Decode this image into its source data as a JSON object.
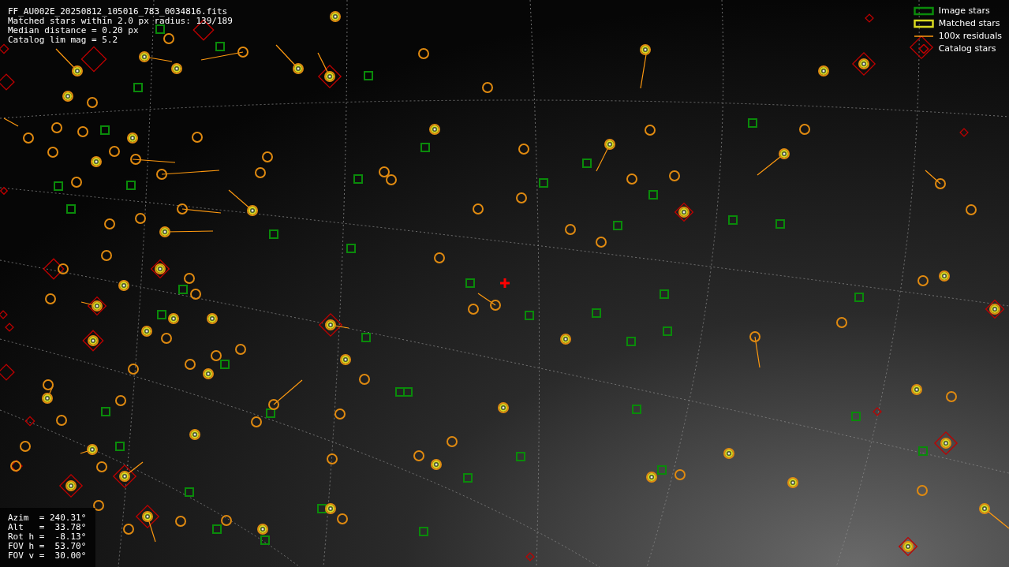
{
  "info": [
    "FF_AU002E_20250812_105016_783_0034816.fits",
    "Matched stars within 2.0 px radius: 139/189",
    "Median distance = 0.20 px",
    "Catalog lim mag = 5.2"
  ],
  "legend": [
    {
      "kind": "image",
      "label": "Image stars"
    },
    {
      "kind": "matched",
      "label": "Matched stars"
    },
    {
      "kind": "residual",
      "label": "100x residuals"
    },
    {
      "kind": "catalog",
      "label": "Catalog stars"
    }
  ],
  "pointing": [
    "Azim  = 240.31°",
    "Alt   =  33.78°",
    "Rot h =  -8.13°",
    "FOV h =  53.70°",
    "FOV v =  30.00°"
  ]
}
